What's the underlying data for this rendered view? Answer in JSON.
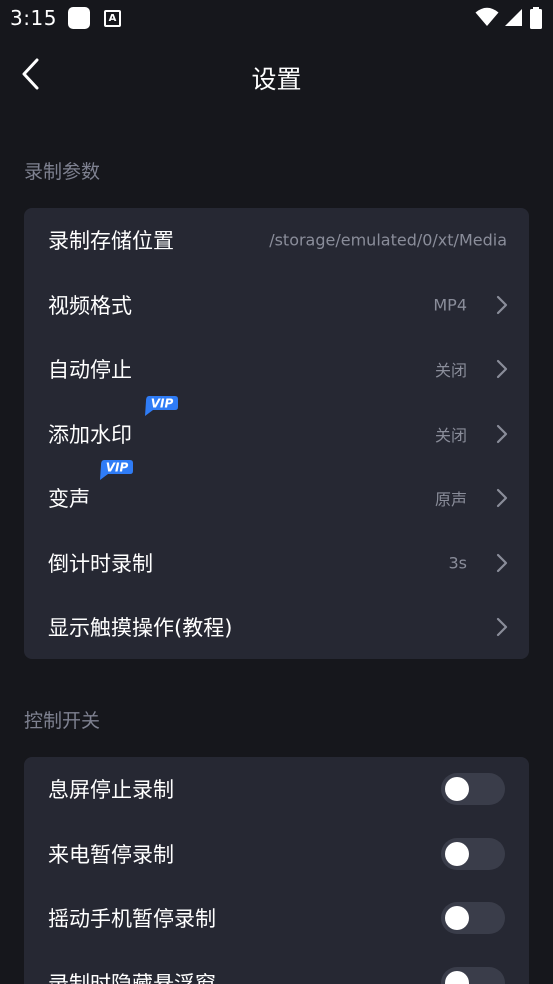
{
  "status_bar": {
    "time": "3:15",
    "notification_badge": "A",
    "icons": [
      "square-app-icon",
      "a-notification-icon",
      "wifi-icon",
      "signal-icon",
      "battery-icon"
    ]
  },
  "header": {
    "title": "设置",
    "back_icon": "chevron-left-icon"
  },
  "sections": {
    "recording": {
      "title": "录制参数",
      "items": [
        {
          "label": "录制存储位置",
          "value": "/storage/emulated/0/xt/Media"
        },
        {
          "label": "视频格式",
          "value": "MP4"
        },
        {
          "label": "自动停止",
          "value": "关闭"
        },
        {
          "label": "添加水印",
          "value": "关闭",
          "badge": "VIP"
        },
        {
          "label": "变声",
          "value": "原声",
          "badge": "VIP"
        },
        {
          "label": "倒计时录制",
          "value": "3s"
        },
        {
          "label": "显示触摸操作(教程)",
          "value": ""
        }
      ]
    },
    "controls": {
      "title": "控制开关",
      "items": [
        {
          "label": "息屏停止录制",
          "on": false
        },
        {
          "label": "来电暂停录制",
          "on": false
        },
        {
          "label": "摇动手机暂停录制",
          "on": false
        },
        {
          "label": "录制时隐藏悬浮窗",
          "on": false
        }
      ]
    }
  },
  "colors": {
    "background": "#16171c",
    "card": "#262833",
    "section_title": "#7e8190",
    "value_text": "#8a8d9a",
    "vip_badge": "#2f7cf6",
    "toggle_off_track": "#3a3d4a"
  }
}
